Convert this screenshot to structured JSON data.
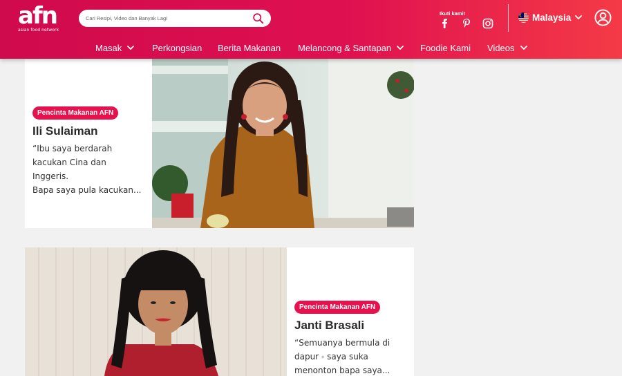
{
  "header": {
    "logo_mark": "afn",
    "logo_tagline": "asian food network",
    "search_placeholder": "Cari Resipi, Video dan Banyak Lagi",
    "follow_label": "Ikuti kami!",
    "country": "Malaysia",
    "icons": [
      "search-icon",
      "facebook-icon",
      "pinterest-icon",
      "instagram-icon",
      "chevron-down-icon",
      "user-icon"
    ]
  },
  "nav": {
    "items": [
      {
        "label": "Masak",
        "dropdown": true
      },
      {
        "label": "Perkongsian",
        "dropdown": false
      },
      {
        "label": "Berita Makanan",
        "dropdown": false
      },
      {
        "label": "Melancong & Santapan",
        "dropdown": true
      },
      {
        "label": "Foodie Kami",
        "dropdown": false
      },
      {
        "label": "Videos",
        "dropdown": true
      }
    ]
  },
  "cards": [
    {
      "badge": "Pencinta Makanan AFN",
      "name": "Ili Sulaiman",
      "quote_lines": [
        "“Ibu saya berdarah",
        "kacukan Cina dan Inggeris.",
        "Bapa saya pula kacukan..."
      ]
    },
    {
      "badge": "Pencinta Makanan AFN",
      "name": "Janti Brasali",
      "quote_lines": [
        "“Semuanya bermula di",
        "dapur - saya suka",
        "menonton bapa saya..."
      ]
    }
  ],
  "colors": {
    "brand_red": "#e5124d",
    "header_start": "#cf0a4d",
    "header_end": "#f43a46",
    "page_bg": "#f1f1f1"
  }
}
